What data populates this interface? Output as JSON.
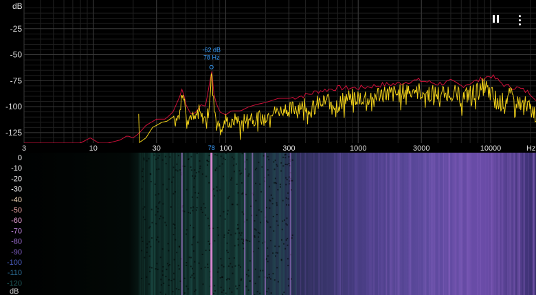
{
  "app": {
    "spectrum_unit": "dB",
    "frequency_unit": "Hz",
    "waterfall_unit": "dB"
  },
  "peak": {
    "level_label": "-62 dB",
    "freq_label": "78 Hz",
    "freq_axis_marker": "78",
    "freq_hz": 78,
    "level_db": -62
  },
  "controls": {
    "pause_icon": "pause-icon",
    "more_icon": "more-vertical-icon"
  },
  "colors": {
    "peak_hold": "#d0103a",
    "live_trace": "#f2d21a",
    "peak_label": "#3aa0ff",
    "grid": "#3a3a3a",
    "axis_text": "#e0e0e0"
  },
  "chart_data": [
    {
      "type": "line",
      "x_scale": "log",
      "xlim": [
        3,
        22000
      ],
      "ylim": [
        -135,
        0
      ],
      "x_ticks": [
        {
          "v": 3,
          "label": "3"
        },
        {
          "v": 10,
          "label": "10"
        },
        {
          "v": 30,
          "label": "30"
        },
        {
          "v": 100,
          "label": "100"
        },
        {
          "v": 300,
          "label": "300"
        },
        {
          "v": 1000,
          "label": "1000"
        },
        {
          "v": 3000,
          "label": "3000"
        },
        {
          "v": 10000,
          "label": "10000"
        }
      ],
      "y_ticks": [
        {
          "v": -25,
          "label": "-25"
        },
        {
          "v": -50,
          "label": "-50"
        },
        {
          "v": -75,
          "label": "-75"
        },
        {
          "v": -100,
          "label": "-100"
        },
        {
          "v": -125,
          "label": "-125"
        }
      ],
      "grid": true,
      "series": [
        {
          "key": "peak_hold",
          "color": "#d0103a",
          "x": [
            3,
            8,
            9.5,
            11,
            13,
            16,
            18,
            20,
            22,
            25,
            30,
            35,
            40,
            45,
            47,
            50,
            55,
            60,
            65,
            70,
            75,
            78,
            82,
            90,
            100,
            110,
            130,
            150,
            170,
            200,
            250,
            300,
            400,
            500,
            700,
            1000,
            1500,
            2000,
            2500,
            3000,
            4000,
            5000,
            6000,
            7000,
            8000,
            10000,
            13000,
            16000,
            20000,
            22000
          ],
          "y": [
            -135,
            -135,
            -130,
            -135,
            -135,
            -132,
            -128,
            -130,
            -126,
            -118,
            -112,
            -112,
            -105,
            -90,
            -82,
            -98,
            -108,
            -105,
            -98,
            -100,
            -80,
            -63,
            -92,
            -105,
            -108,
            -104,
            -104,
            -100,
            -98,
            -96,
            -92,
            -92,
            -89,
            -85,
            -82,
            -82,
            -79,
            -78,
            -75,
            -75,
            -78,
            -76,
            -80,
            -77,
            -75,
            -70,
            -80,
            -82,
            -87,
            -92
          ]
        },
        {
          "key": "live",
          "color": "#f2d21a",
          "x": [
            22,
            25,
            28,
            30,
            33,
            36,
            40,
            43,
            45,
            47,
            50,
            52,
            55,
            58,
            60,
            62,
            65,
            70,
            74,
            77,
            78,
            80,
            84,
            90,
            95,
            100,
            110,
            120,
            130,
            140,
            150,
            160,
            170,
            180,
            200,
            220,
            250,
            280,
            300,
            350,
            400,
            450,
            500,
            600,
            700,
            800,
            1000,
            1200,
            1500,
            2000,
            2500,
            3000,
            4000,
            5000,
            6000,
            7000,
            8000,
            9000,
            10000,
            12000,
            14000,
            16000,
            18000,
            20000,
            22000
          ],
          "y": [
            -135,
            -130,
            -120,
            -118,
            -115,
            -114,
            -110,
            -108,
            -95,
            -85,
            -102,
            -112,
            -108,
            -113,
            -110,
            -101,
            -110,
            -112,
            -105,
            -80,
            -65,
            -90,
            -110,
            -115,
            -120,
            -112,
            -118,
            -110,
            -118,
            -110,
            -112,
            -106,
            -112,
            -108,
            -110,
            -104,
            -105,
            -100,
            -105,
            -99,
            -96,
            -103,
            -97,
            -94,
            -98,
            -92,
            -91,
            -90,
            -87,
            -88,
            -82,
            -86,
            -88,
            -85,
            -92,
            -87,
            -85,
            -80,
            -88,
            -96,
            -90,
            -95,
            -98,
            -102,
            -107
          ]
        }
      ]
    },
    {
      "type": "heatmap",
      "x_scale": "log",
      "xlim": [
        3,
        22000
      ],
      "y_label_unit": "dB",
      "y_ticks": [
        {
          "label": "0",
          "color": "#ffffff"
        },
        {
          "label": "-10",
          "color": "#ffffff"
        },
        {
          "label": "-20",
          "color": "#ffffff"
        },
        {
          "label": "-30",
          "color": "#ffffff"
        },
        {
          "label": "-40",
          "color": "#f4d8b8"
        },
        {
          "label": "-50",
          "color": "#f0a8a8"
        },
        {
          "label": "-60",
          "color": "#e8a0d8"
        },
        {
          "label": "-70",
          "color": "#c088e0"
        },
        {
          "label": "-80",
          "color": "#a070d8"
        },
        {
          "label": "-90",
          "color": "#8060c8"
        },
        {
          "label": "-100",
          "color": "#4a5ec0"
        },
        {
          "label": "-110",
          "color": "#2a6a90"
        },
        {
          "label": "-120",
          "color": "#1f5a5a"
        }
      ],
      "bands": [
        {
          "f": 47,
          "strength": 0.55
        },
        {
          "f": 78,
          "strength": 1.0
        },
        {
          "f": 140,
          "strength": 0.5
        },
        {
          "f": 160,
          "strength": 0.45
        },
        {
          "f": 200,
          "strength": 0.4
        },
        {
          "f": 310,
          "strength": 0.35
        }
      ]
    }
  ]
}
